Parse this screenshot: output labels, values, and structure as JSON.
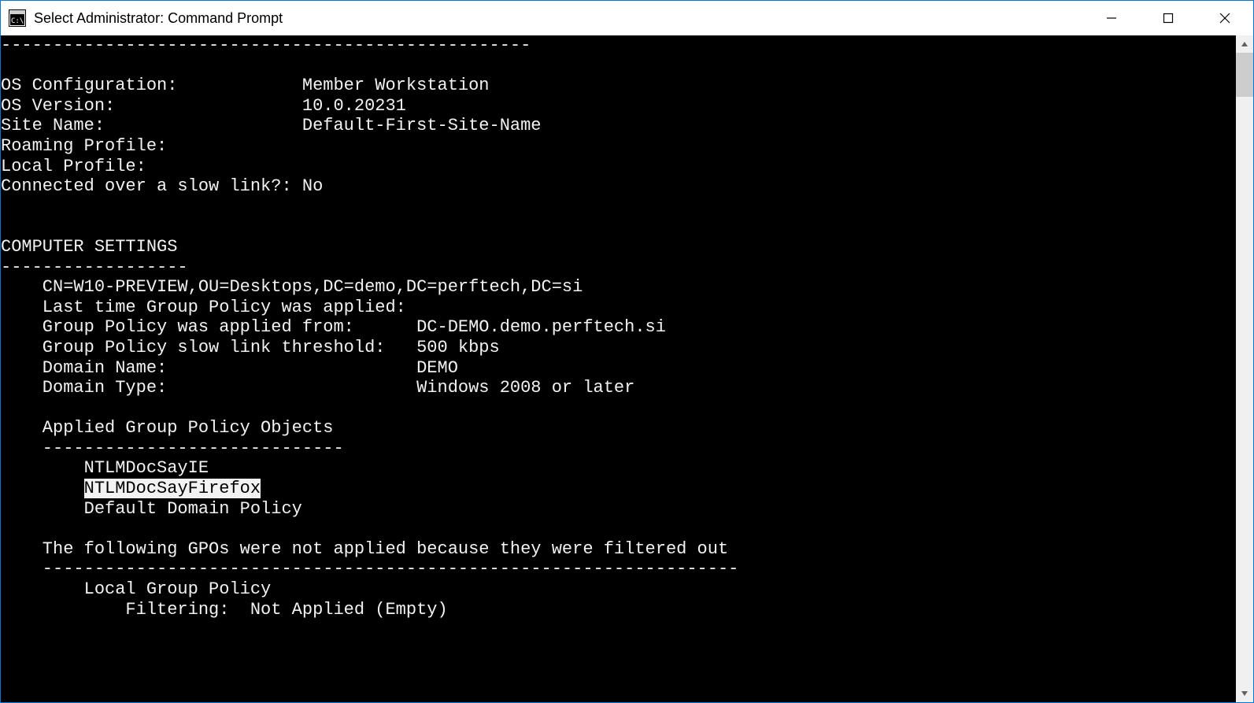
{
  "window": {
    "title": "Select Administrator: Command Prompt"
  },
  "terminal": {
    "lines": [
      {
        "indent": "",
        "text": "---------------------------------------------------"
      },
      {
        "indent": "",
        "text": ""
      },
      {
        "indent": "",
        "text": "OS Configuration:            Member Workstation"
      },
      {
        "indent": "",
        "text": "OS Version:                  10.0.20231"
      },
      {
        "indent": "",
        "text": "Site Name:                   Default-First-Site-Name"
      },
      {
        "indent": "",
        "text": "Roaming Profile:"
      },
      {
        "indent": "",
        "text": "Local Profile:"
      },
      {
        "indent": "",
        "text": "Connected over a slow link?: No"
      },
      {
        "indent": "",
        "text": ""
      },
      {
        "indent": "",
        "text": ""
      },
      {
        "indent": "",
        "text": "COMPUTER SETTINGS"
      },
      {
        "indent": "",
        "text": "------------------"
      },
      {
        "indent": "    ",
        "text": "CN=W10-PREVIEW,OU=Desktops,DC=demo,DC=perftech,DC=si"
      },
      {
        "indent": "    ",
        "text": "Last time Group Policy was applied:"
      },
      {
        "indent": "    ",
        "text": "Group Policy was applied from:      DC-DEMO.demo.perftech.si"
      },
      {
        "indent": "    ",
        "text": "Group Policy slow link threshold:   500 kbps"
      },
      {
        "indent": "    ",
        "text": "Domain Name:                        DEMO"
      },
      {
        "indent": "    ",
        "text": "Domain Type:                        Windows 2008 or later"
      },
      {
        "indent": "",
        "text": ""
      },
      {
        "indent": "    ",
        "text": "Applied Group Policy Objects"
      },
      {
        "indent": "    ",
        "text": "-----------------------------"
      },
      {
        "indent": "        ",
        "text": "NTLMDocSayIE"
      },
      {
        "indent": "        ",
        "text": "NTLMDocSayFirefox",
        "highlight": true
      },
      {
        "indent": "        ",
        "text": "Default Domain Policy"
      },
      {
        "indent": "",
        "text": ""
      },
      {
        "indent": "    ",
        "text": "The following GPOs were not applied because they were filtered out"
      },
      {
        "indent": "    ",
        "text": "-------------------------------------------------------------------"
      },
      {
        "indent": "        ",
        "text": "Local Group Policy"
      },
      {
        "indent": "            ",
        "text": "Filtering:  Not Applied (Empty)"
      }
    ]
  }
}
